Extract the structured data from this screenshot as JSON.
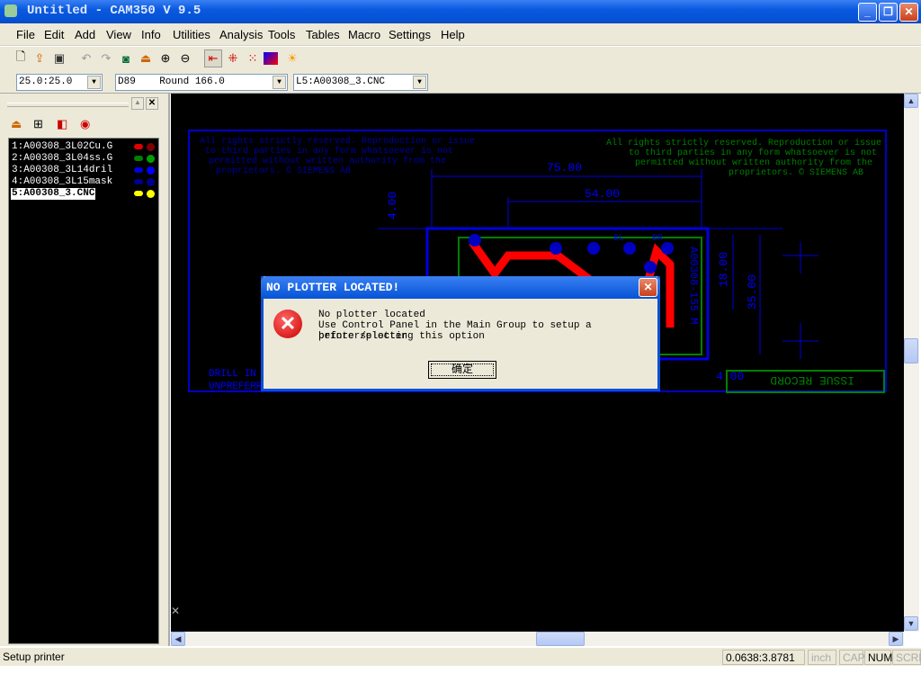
{
  "window": {
    "title": "Untitled - CAM350 V 9.5"
  },
  "menu": [
    "File",
    "Edit",
    "Add",
    "View",
    "Info",
    "Utilities",
    "Analysis",
    "Tools",
    "Tables",
    "Macro",
    "Settings",
    "Help"
  ],
  "toolbar_icons": [
    "new-icon",
    "open-icon",
    "save-icon",
    "undo-icon",
    "redo-icon",
    "zoom-window-icon",
    "clean-icon",
    "zoom-in-icon",
    "zoom-out-icon",
    "select-icon",
    "grid-icon",
    "grid-dots-icon",
    "color-icon",
    "layer-icon"
  ],
  "combos": {
    "grid": "25.0:25.0",
    "dcode": "D89    Round 166.0",
    "layer": "L5:A00308_3.CNC"
  },
  "layers": [
    {
      "label": "1:A00308_3L02Cu.G",
      "color": "#e00000",
      "color2": "#800000"
    },
    {
      "label": "2:A00308_3L04ss.G",
      "color": "#008000",
      "color2": "#00a000"
    },
    {
      "label": "3:A00308_3L14dril",
      "color": "#0000e0",
      "color2": "#0000ff"
    },
    {
      "label": "4:A00308_3L15mask",
      "color": "#000090",
      "color2": "#000090"
    },
    {
      "label": "5:A00308_3.CNC",
      "color": "#ffff00",
      "color2": "#ffff00",
      "selected": true
    }
  ],
  "drawing": {
    "dim1": "75.00",
    "dim2": "54.00",
    "dim3": "4.00",
    "dim4": "18.00",
    "dim5": "35.00",
    "dim6": "4.00",
    "part_no": "A00308-155 M",
    "issue_record": "ISSUE RECORD",
    "notice_left": [
      "All rights strictly reserved. Reproduction or issue",
      "to third parties in any form whatsoever is not",
      "permitted without written authority from the",
      "proprietors. © SIEMENS AB"
    ],
    "notice_right": [
      "All rights strictly reserved. Reproduction or issue",
      "to third parties in any form whatsoever is not",
      "permitted without written authority from the",
      "proprietors. © SIEMENS AB"
    ],
    "drill_label": "DRILL IN",
    "unpref_label": "UNPREFERR",
    "labels": [
      "BL",
      "BR"
    ]
  },
  "dialog": {
    "title": "NO PLOTTER LOCATED!",
    "lines": [
      "No plotter located",
      "Use Control Panel in the Main Group to setup a printer/plotter",
      "before selecting this option"
    ],
    "ok": "确定"
  },
  "status": {
    "message": "Setup printer",
    "coords": "0.0638:3.8781",
    "units": "inch",
    "cap": "CAP",
    "num": "NUM",
    "scrl": "SCRL"
  }
}
